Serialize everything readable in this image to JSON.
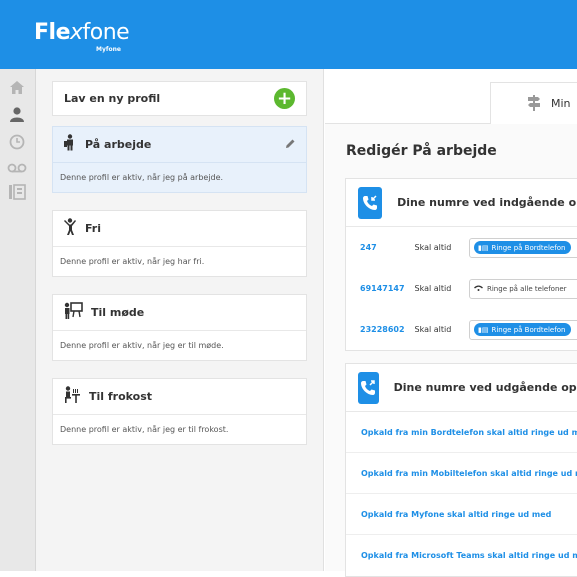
{
  "brand": {
    "name_bold": "Fle",
    "name_mid": "x",
    "name_rest": "fone",
    "sub": "Myfone"
  },
  "rail": [
    "home-icon",
    "user-icon",
    "clock-icon",
    "voicemail-icon",
    "phonebook-icon"
  ],
  "profiles": {
    "new_label": "Lav en ny profil",
    "items": [
      {
        "title": "På arbejde",
        "desc": "Denne profil er aktiv, når jeg på arbejde.",
        "icon": "worker-icon"
      },
      {
        "title": "Fri",
        "desc": "Denne profil er aktiv, når jeg har fri.",
        "icon": "leisure-icon"
      },
      {
        "title": "Til møde",
        "desc": "Denne profil er aktiv, når jeg er til møde.",
        "icon": "meeting-icon"
      },
      {
        "title": "Til frokost",
        "desc": "Denne profil er aktiv, når jeg er til frokost.",
        "icon": "lunch-icon"
      }
    ]
  },
  "tab": {
    "label": "Min"
  },
  "edit": {
    "title": "Redigér På arbejde",
    "incoming": {
      "title": "Dine numre ved indgående op",
      "rows": [
        {
          "number": "247",
          "rule": "Skal altid",
          "option": "Ringe på Bordtelefon",
          "style": "pill"
        },
        {
          "number": "69147147",
          "rule": "Skal altid",
          "option": "Ringe på alle telefoner",
          "style": "plain"
        },
        {
          "number": "23228602",
          "rule": "Skal altid",
          "option": "Ringe på Bordtelefon",
          "style": "pill"
        }
      ]
    },
    "outgoing": {
      "title": "Dine numre ved udgående opk",
      "rows": [
        "Opkald fra min Bordtelefon skal altid ringe ud m",
        "Opkald fra min Mobiltelefon skal altid ringe ud m",
        "Opkald fra Myfone skal altid ringe ud med",
        "Opkald fra Microsoft Teams skal altid ringe ud m"
      ]
    }
  },
  "colors": {
    "accent": "#1e8fe6",
    "add": "#5cb82f",
    "active_card": "#e8f1fb"
  }
}
